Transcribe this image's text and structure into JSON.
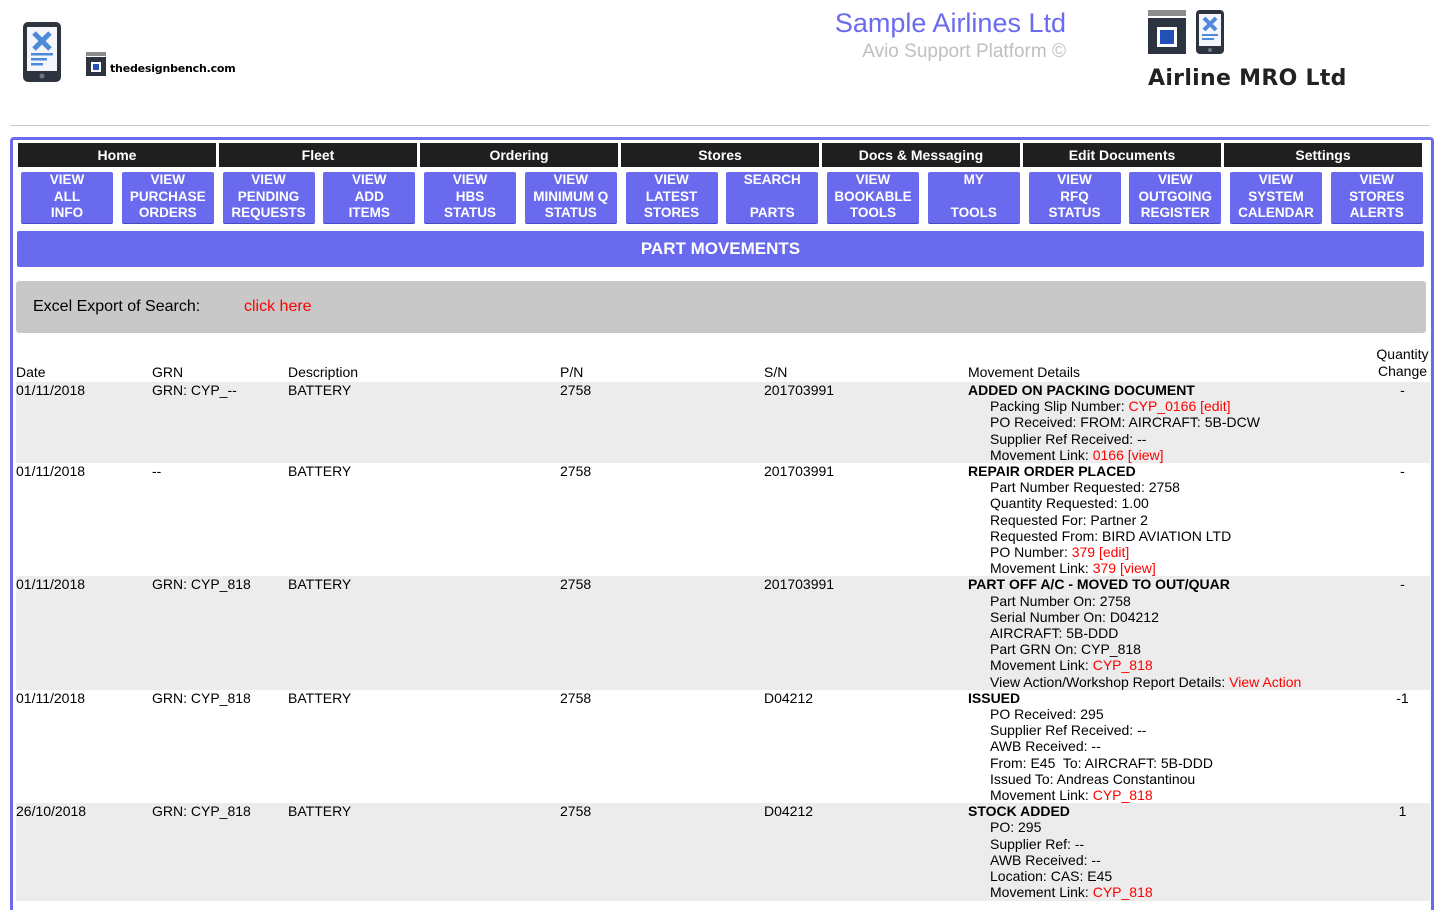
{
  "header": {
    "db_logo_text": "thedesignbench.com",
    "title": "Sample Airlines Ltd",
    "subtitle": "Avio Support Platform ©",
    "mro_name": "Airline MRO Ltd"
  },
  "nav": {
    "categories": [
      "Home",
      "Fleet",
      "Ordering",
      "Stores",
      "Docs & Messaging",
      "Edit Documents",
      "Settings"
    ],
    "buttons": [
      [
        "VIEW",
        "ALL",
        "INFO"
      ],
      [
        "VIEW",
        "PURCHASE",
        "ORDERS"
      ],
      [
        "VIEW",
        "PENDING",
        "REQUESTS"
      ],
      [
        "VIEW",
        "ADD",
        "ITEMS"
      ],
      [
        "VIEW",
        "HBS",
        "STATUS"
      ],
      [
        "VIEW",
        "MINIMUM Q",
        "STATUS"
      ],
      [
        "VIEW",
        "LATEST",
        "STORES"
      ],
      [
        "SEARCH",
        "",
        "PARTS"
      ],
      [
        "VIEW",
        "BOOKABLE",
        "TOOLS"
      ],
      [
        "MY",
        "",
        "TOOLS"
      ],
      [
        "VIEW",
        "RFQ",
        "STATUS"
      ],
      [
        "VIEW",
        "OUTGOING",
        "REGISTER"
      ],
      [
        "VIEW",
        "SYSTEM",
        "CALENDAR"
      ],
      [
        "VIEW",
        "STORES",
        "ALERTS"
      ]
    ]
  },
  "section_title": "PART MOVEMENTS",
  "export": {
    "label": "Excel Export of Search:",
    "link": "click here"
  },
  "table": {
    "headers": {
      "date": "Date",
      "grn": "GRN",
      "desc": "Description",
      "pn": "P/N",
      "sn": "S/N",
      "mov": "Movement Details",
      "qty": "Quantity Change"
    },
    "rows": [
      {
        "date": "01/11/2018",
        "grn": "GRN: CYP_--",
        "desc": "BATTERY",
        "pn": "2758",
        "sn": "201703991",
        "title": "ADDED ON PACKING DOCUMENT",
        "lines": [
          {
            "text": "Packing Slip Number: ",
            "link": "CYP_0166 [edit]"
          },
          {
            "text": "PO Received: FROM: AIRCRAFT: 5B-DCW"
          },
          {
            "text": "Supplier Ref Received: --"
          },
          {
            "text": "Movement Link: ",
            "link": "0166 [view]"
          }
        ],
        "qty": "-"
      },
      {
        "date": "01/11/2018",
        "grn": "--",
        "desc": "BATTERY",
        "pn": "2758",
        "sn": "201703991",
        "title": "REPAIR ORDER PLACED",
        "lines": [
          {
            "text": "Part Number Requested: 2758"
          },
          {
            "text": "Quantity Requested: 1.00"
          },
          {
            "text": "Requested For: Partner 2"
          },
          {
            "text": "Requested From: BIRD AVIATION LTD"
          },
          {
            "text": "PO Number: ",
            "link": "379 [edit]"
          },
          {
            "text": "Movement Link: ",
            "link": "379 [view]"
          }
        ],
        "qty": "-"
      },
      {
        "date": "01/11/2018",
        "grn": "GRN: CYP_818",
        "desc": "BATTERY",
        "pn": "2758",
        "sn": "201703991",
        "title": "PART OFF A/C - MOVED TO OUT/QUAR",
        "lines": [
          {
            "text": "Part Number On: 2758"
          },
          {
            "text": "Serial Number On: D04212"
          },
          {
            "text": "AIRCRAFT: 5B-DDD"
          },
          {
            "text": "Part GRN On: CYP_818"
          },
          {
            "text": "Movement Link: ",
            "link": "CYP_818"
          },
          {
            "text": "View Action/Workshop Report Details: ",
            "link": "View Action"
          }
        ],
        "qty": "-"
      },
      {
        "date": "01/11/2018",
        "grn": "GRN: CYP_818",
        "desc": "BATTERY",
        "pn": "2758",
        "sn": "D04212",
        "title": "ISSUED",
        "lines": [
          {
            "text": "PO Received: 295"
          },
          {
            "text": "Supplier Ref Received: --"
          },
          {
            "text": "AWB Received: --"
          },
          {
            "text": "From: E45  To: AIRCRAFT: 5B-DDD"
          },
          {
            "text": "Issued To: Andreas Constantinou"
          },
          {
            "text": "Movement Link: ",
            "link": "CYP_818"
          }
        ],
        "qty": "-1"
      },
      {
        "date": "26/10/2018",
        "grn": "GRN: CYP_818",
        "desc": "BATTERY",
        "pn": "2758",
        "sn": "D04212",
        "title": "STOCK ADDED",
        "lines": [
          {
            "text": "PO: 295"
          },
          {
            "text": "Supplier Ref: --"
          },
          {
            "text": "AWB Received: --"
          },
          {
            "text": "Location: CAS: E45"
          },
          {
            "text": "Movement Link: ",
            "link": "CYP_818"
          }
        ],
        "qty": "1"
      }
    ]
  }
}
